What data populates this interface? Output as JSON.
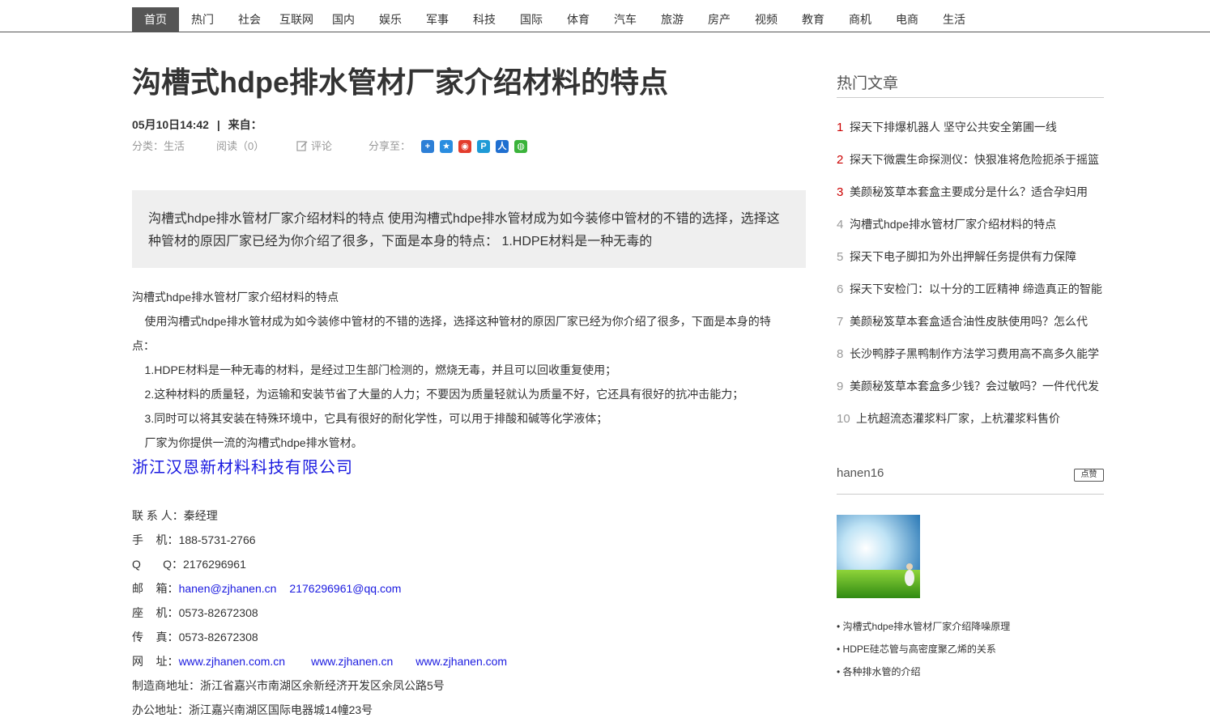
{
  "nav": {
    "items": [
      "首页",
      "热门",
      "社会",
      "互联网",
      "国内",
      "娱乐",
      "军事",
      "科技",
      "国际",
      "体育",
      "汽车",
      "旅游",
      "房产",
      "视频",
      "教育",
      "商机",
      "电商",
      "生活"
    ]
  },
  "article": {
    "title": "沟槽式hdpe排水管材厂家介绍材料的特点",
    "date": "05月10日14:42",
    "separator": "|",
    "source_label": "来自：",
    "category": "分类：生活",
    "reads": "阅读（0）",
    "comment": "评论",
    "share_label": "分享至：",
    "share_icons": [
      "qzone-icon",
      "qq-icon",
      "weibo-icon",
      "tencent-weibo-icon",
      "renren-icon",
      "wechat-icon"
    ],
    "summary": "沟槽式hdpe排水管材厂家介绍材料的特点 使用沟槽式hdpe排水管材成为如今装修中管材的不错的选择，选择这种管材的原因厂家已经为你介绍了很多，下面是本身的特点： 1.HDPE材料是一种无毒的",
    "paragraphs": [
      " 沟槽式hdpe排水管材厂家介绍材料的特点",
      "    使用沟槽式hdpe排水管材成为如今装修中管材的不错的选择，选择这种管材的原因厂家已经为你介绍了很多，下面是本身的特",
      "点：",
      "    1.HDPE材料是一种无毒的材料，是经过卫生部门检测的，燃烧无毒，并且可以回收重复使用；",
      "    2.这种材料的质量轻，为运输和安装节省了大量的人力；不要因为质量轻就认为质量不好，它还具有很好的抗冲击能力；",
      "    3.同时可以将其安装在特殊环境中，它具有很好的耐化学性，可以用于排酸和碱等化学液体；",
      "    厂家为你提供一流的沟槽式hdpe排水管材。"
    ],
    "company": "浙江汉恩新材料科技有限公司",
    "contact": {
      "person_label": "联 系 人：",
      "person": "秦经理",
      "phone_label": "手    机：",
      "phone": "188-5731-2766",
      "qq_label": "Q       Q：",
      "qq": "2176296961",
      "email_label": "邮    箱：",
      "email1": "hanen@zjhanen.cn",
      "email2": "2176296961@qq.com",
      "tel_label": "座    机：",
      "tel": "0573-82672308",
      "fax_label": "传    真：",
      "fax": "0573-82672308",
      "web_label": "网    址：",
      "web1": "www.zjhanen.com.cn",
      "web2": "www.zjhanen.cn",
      "web3": "www.zjhanen.com",
      "factory_label": "制造商地址：",
      "factory": "浙江省嘉兴市南湖区余新经济开发区余凤公路5号",
      "office_label": "办公地址：",
      "office": "浙江嘉兴南湖区国际电器城14幢23号"
    }
  },
  "sidebar": {
    "hot_title": "热门文章",
    "hot": [
      {
        "num": "1",
        "title": "探天下排爆机器人 坚守公共安全第圃一线"
      },
      {
        "num": "2",
        "title": "探天下微震生命探测仪：快狠准将危险扼杀于摇篮"
      },
      {
        "num": "3",
        "title": "美颜秘笈草本套盒主要成分是什么？适合孕妇用"
      },
      {
        "num": "4",
        "title": "沟槽式hdpe排水管材厂家介绍材料的特点"
      },
      {
        "num": "5",
        "title": "探天下电子脚扣为外出押解任务提供有力保障"
      },
      {
        "num": "6",
        "title": "探天下安检门：以十分的工匠精神 缔造真正的智能"
      },
      {
        "num": "7",
        "title": "美颜秘笈草本套盒适合油性皮肤使用吗？怎么代"
      },
      {
        "num": "8",
        "title": "长沙鸭脖子黑鸭制作方法学习费用高不高多久能学"
      },
      {
        "num": "9",
        "title": "美颜秘笈草本套盒多少钱？会过敏吗？一件代代发"
      },
      {
        "num": "10",
        "title": "上杭超流态灌浆料厂家，上杭灌浆料售价"
      }
    ],
    "username": "hanen16",
    "like_label": "点赞",
    "related": [
      "沟槽式hdpe排水管材厂家介绍降噪原理",
      "HDPE硅芯管与高密度聚乙烯的关系",
      "各种排水管的介绍"
    ]
  },
  "colors": {
    "nav_active_bg": "#555555",
    "summary_bg": "#efefef",
    "link_blue": "#1a1ae0",
    "rank_red": "#cc0000"
  }
}
